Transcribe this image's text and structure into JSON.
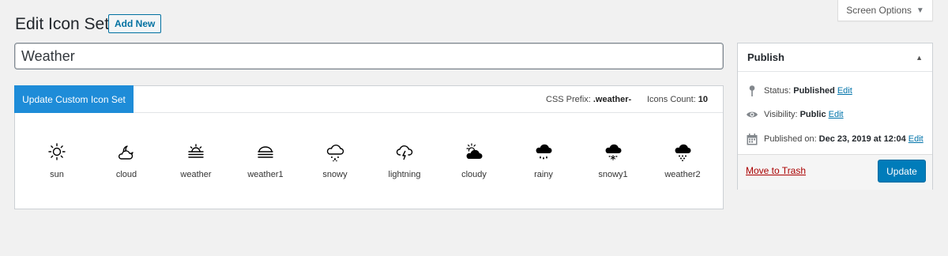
{
  "header": {
    "title": "Edit Icon Set",
    "add_new_label": "Add New",
    "screen_options_label": "Screen Options"
  },
  "title_field": {
    "value": "Weather"
  },
  "icon_panel": {
    "update_button_label": "Update Custom Icon Set",
    "css_prefix_label": "CSS Prefix:",
    "css_prefix_value": ".weather-",
    "icons_count_label": "Icons Count:",
    "icons_count_value": "10",
    "icons": [
      {
        "name": "sun",
        "icon": "sun-icon"
      },
      {
        "name": "cloud",
        "icon": "cloud-moon-icon"
      },
      {
        "name": "weather",
        "icon": "sunrise-fog-icon"
      },
      {
        "name": "weather1",
        "icon": "cloud-fog-icon"
      },
      {
        "name": "snowy",
        "icon": "cloud-snow-icon"
      },
      {
        "name": "lightning",
        "icon": "cloud-lightning-icon"
      },
      {
        "name": "cloudy",
        "icon": "cloud-sun-filled-icon"
      },
      {
        "name": "rainy",
        "icon": "cloud-rain-filled-icon"
      },
      {
        "name": "snowy1",
        "icon": "cloud-snowflake-filled-icon"
      },
      {
        "name": "weather2",
        "icon": "cloud-snow-dots-filled-icon"
      }
    ]
  },
  "publish": {
    "title": "Publish",
    "status_label": "Status:",
    "status_value": "Published",
    "visibility_label": "Visibility:",
    "visibility_value": "Public",
    "published_label": "Published on:",
    "published_value": "Dec 23, 2019 at 12:04",
    "edit_label": "Edit",
    "trash_label": "Move to Trash",
    "update_label": "Update"
  },
  "colors": {
    "primary": "#007cba",
    "panel_button": "#1e8cd8",
    "trash": "#a00000",
    "link": "#0073aa"
  }
}
